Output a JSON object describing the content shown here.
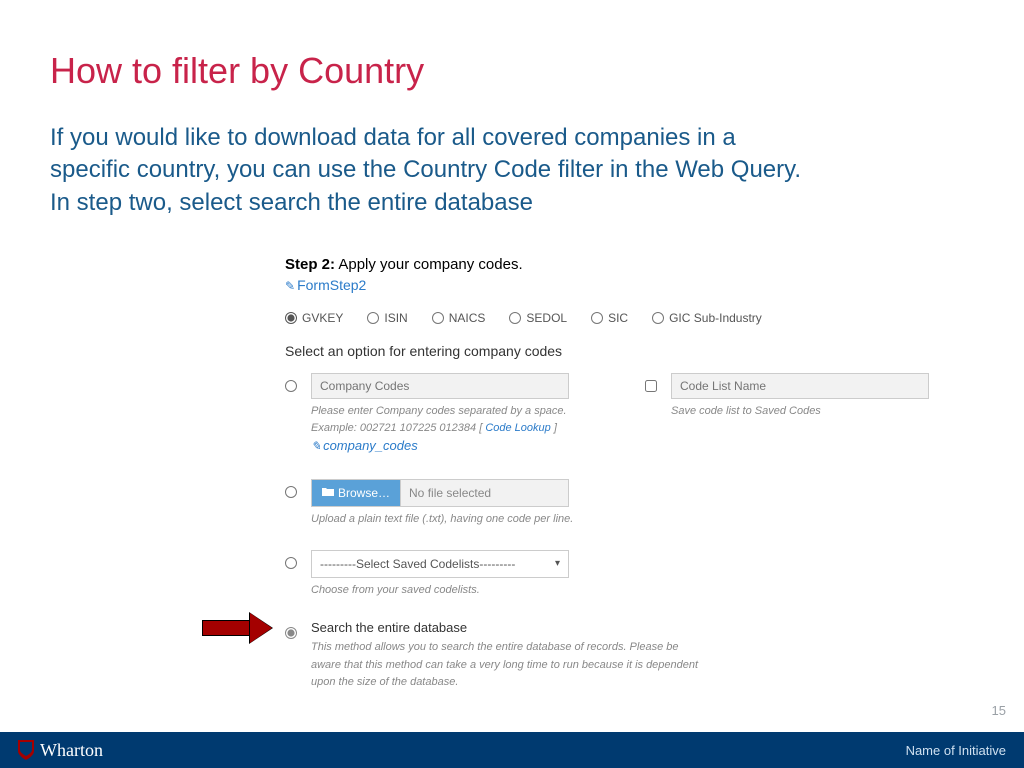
{
  "title": "How to filter by Country",
  "subtitle": "If you would like to download data for all covered companies in a specific country, you can use the Country Code filter in the Web Query. In step two, select search the entire database",
  "step": {
    "label": "Step 2:",
    "text": "Apply your company codes.",
    "form_link": "FormStep2"
  },
  "code_types": {
    "selected": "GVKEY",
    "options": [
      "GVKEY",
      "ISIN",
      "NAICS",
      "SEDOL",
      "SIC",
      "GIC Sub-Industry"
    ]
  },
  "select_prompt": "Select an option for entering company codes",
  "company_codes": {
    "placeholder": "Company Codes",
    "helper1": "Please enter Company codes separated by a space.",
    "helper2_prefix": "Example: 002721 107225 012384 [ ",
    "code_lookup": "Code Lookup",
    "helper2_suffix": " ]",
    "link": "company_codes"
  },
  "code_list": {
    "placeholder": "Code List Name",
    "helper": "Save code list to Saved Codes"
  },
  "browse": {
    "button": "Browse…",
    "no_file": "No file selected",
    "helper": "Upload a plain text file (.txt), having one code per line."
  },
  "saved_codelists": {
    "placeholder": "---------Select Saved Codelists---------",
    "helper": "Choose from your saved codelists."
  },
  "search_db": {
    "label": "Search the entire database",
    "helper": "This method allows you to search the entire database of records. Please be aware that this method can take a very long time to run because it is dependent upon the size of the database."
  },
  "page_number": "15",
  "footer": {
    "brand": "Wharton",
    "initiative": "Name of Initiative"
  }
}
